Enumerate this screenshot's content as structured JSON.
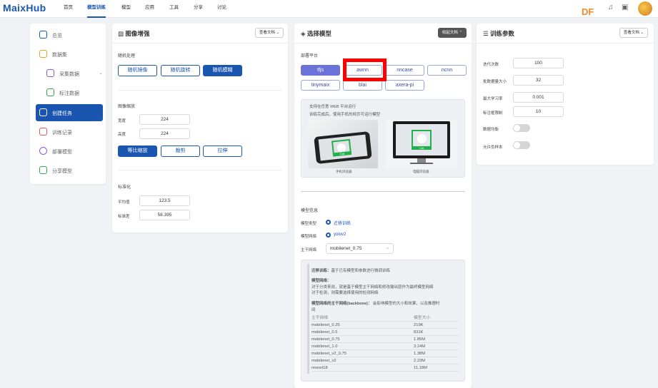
{
  "topbar": {
    "logo": "MaixHub",
    "nav": [
      "首页",
      "模型训练",
      "模型",
      "应用",
      "工具",
      "分享",
      "讨论"
    ],
    "active_nav": "模型训练",
    "df": "DF"
  },
  "sidebar": {
    "items": [
      {
        "label": "总览",
        "icon": "home-icon"
      },
      {
        "label": "数据集",
        "icon": "dataset-icon"
      },
      {
        "label": "采集数据",
        "icon": "capture-icon"
      },
      {
        "label": "标注数据",
        "icon": "annotate-icon"
      },
      {
        "label": "创建任务",
        "icon": "create-task-icon"
      },
      {
        "label": "训练记录",
        "icon": "history-icon"
      },
      {
        "label": "部署模型",
        "icon": "deploy-icon"
      },
      {
        "label": "分享模型",
        "icon": "share-icon"
      }
    ],
    "active": "创建任务"
  },
  "augment": {
    "title": "图像增强",
    "doc_btn": "查看文档",
    "random_section": "随机处理",
    "random_buttons": [
      "随机镜像",
      "随机旋转",
      "随机模糊"
    ],
    "resize_section": "图像缩放",
    "width_label": "宽度",
    "width_value": "224",
    "height_label": "高度",
    "height_value": "224",
    "resize_buttons": [
      "等比缩放",
      "裁剪",
      "拉伸"
    ],
    "norm_section": "标准化",
    "mean_label": "平均值",
    "mean_value": "123.5",
    "std_label": "标准差",
    "std_value": "58.395"
  },
  "model": {
    "title": "选择模型",
    "doc_btn": "收起文档",
    "platform_section": "部署平台",
    "platforms": [
      "tfjs",
      "awnn",
      "nncase",
      "ncnn",
      "tinymaix",
      "blai",
      "axera-pi"
    ],
    "selected_platform": "tfjs",
    "support_line1": "支持在任意 WEB 平台运行",
    "support_line2": "训练完成后，使用手机的网页可运行模型",
    "phone_caption": "手机浏览器",
    "pc_caption": "电脑浏览器",
    "cat_label": "Cat",
    "info_section": "模型信息",
    "type_label": "模型类型",
    "type_value": "迁移训练",
    "net_label": "模型网络",
    "net_value": "yolov2",
    "backbone_label": "主干网络",
    "backbone_value": "mobilenet_0.75",
    "doc_transfer_title": "迁移训练：",
    "doc_transfer_text": "基于已有模型和参数进行微调训练",
    "doc_net_title": "模型网络：",
    "doc_net_text1": "对于分类来说，就是基于模型主干网络和修改输出层作为最终模型网络",
    "doc_net_text2": "对于检测，则需要选择使用的检测网络",
    "doc_backbone_title": "模型网络的主干网络(backbone)：",
    "doc_backbone_text1": "会影响模型的大小和效果，以及推理时",
    "doc_backbone_text2": "间",
    "table_headers": [
      "主干网络",
      "模型大小"
    ],
    "table_rows": [
      [
        "mobilenet_0.25",
        "219K"
      ],
      [
        "mobilenet_0.5",
        "831K"
      ],
      [
        "mobilenet_0.75",
        "1.85M"
      ],
      [
        "mobilenet_1.0",
        "3.24M"
      ],
      [
        "mobilenet_v2_0.75",
        "1.38M"
      ],
      [
        "mobilenet_v2",
        "2.23M"
      ],
      [
        "resnet18",
        "11.18M"
      ]
    ]
  },
  "params": {
    "title": "训练参数",
    "doc_btn": "查看文档",
    "fields": [
      {
        "label": "迭代次数",
        "value": "100"
      },
      {
        "label": "批数据量大小",
        "value": "32"
      },
      {
        "label": "最大学习率",
        "value": "0.001"
      },
      {
        "label": "标注框限制",
        "value": "10"
      }
    ],
    "toggles": [
      {
        "label": "数据均衡",
        "on": false
      },
      {
        "label": "允许负样本",
        "on": false
      }
    ]
  }
}
